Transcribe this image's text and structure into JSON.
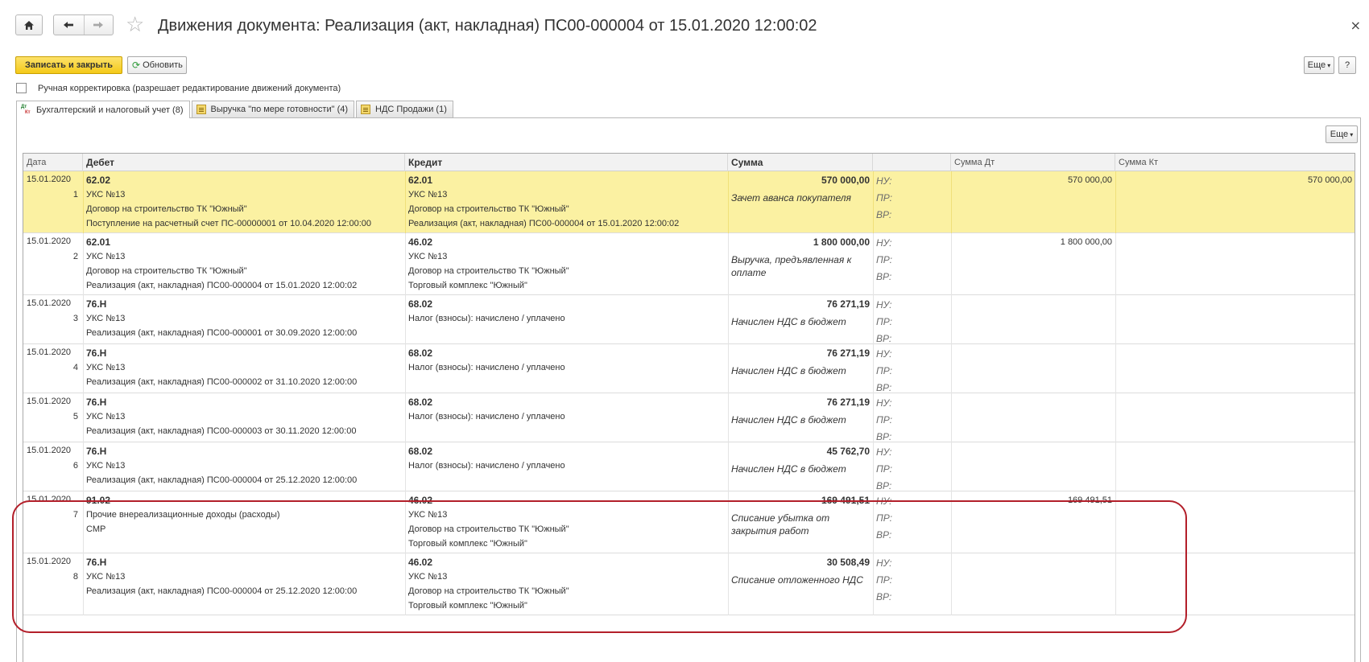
{
  "window": {
    "title": "Движения документа: Реализация (акт, накладная) ПС00-000004 от 15.01.2020 12:00:02",
    "close_glyph": "×"
  },
  "toolbar": {
    "save_close": "Записать и закрыть",
    "refresh": "Обновить",
    "more": "Еще",
    "help": "?"
  },
  "manual": {
    "label": "Ручная корректировка (разрешает редактирование движений документа)",
    "checked": false
  },
  "tabs": [
    {
      "label": "Бухгалтерский и налоговый учет (8)",
      "icon_d": "Дт",
      "icon_k": "Кт"
    },
    {
      "label": "Выручка \"по мере готовности\" (4)"
    },
    {
      "label": "НДС Продажи (1)"
    }
  ],
  "grid": {
    "more": "Еще",
    "headers": {
      "date": "Дата",
      "debit": "Дебет",
      "credit": "Кредит",
      "sum": "Сумма",
      "sum_dt": "Сумма Дт",
      "sum_kt": "Сумма Кт"
    },
    "tags": {
      "nu": "НУ:",
      "pr": "ПР:",
      "vr": "ВР:"
    },
    "rows": [
      {
        "date": "15.01.2020",
        "n": "1",
        "debit": {
          "account": "62.02",
          "sub": [
            "УКС №13",
            "Договор на строительство ТК \"Южный\"",
            "Поступление на расчетный счет ПС-00000001 от 10.04.2020 12:00:00"
          ]
        },
        "credit": {
          "account": "62.01",
          "sub": [
            "УКС №13",
            "Договор на строительство ТК \"Южный\"",
            "Реализация (акт, накладная) ПС00-000004 от 15.01.2020 12:00:02"
          ]
        },
        "sum": "570 000,00",
        "content": "Зачет аванса покупателя",
        "sum_dt": "570 000,00",
        "sum_kt": "570 000,00"
      },
      {
        "date": "15.01.2020",
        "n": "2",
        "debit": {
          "account": "62.01",
          "sub": [
            "УКС №13",
            "Договор на строительство ТК \"Южный\"",
            "Реализация (акт, накладная) ПС00-000004 от 15.01.2020 12:00:02"
          ]
        },
        "credit": {
          "account": "46.02",
          "sub": [
            "УКС №13",
            "Договор на строительство ТК \"Южный\"",
            "Торговый комплекс \"Южный\""
          ]
        },
        "sum": "1 800 000,00",
        "content": "Выручка, предъявленная к оплате",
        "sum_dt": "1 800 000,00",
        "sum_kt": ""
      },
      {
        "date": "15.01.2020",
        "n": "3",
        "debit": {
          "account": "76.Н",
          "sub": [
            "УКС №13",
            "Реализация (акт, накладная) ПС00-000001 от 30.09.2020 12:00:00"
          ]
        },
        "credit": {
          "account": "68.02",
          "sub": [
            "Налог (взносы): начислено / уплачено"
          ]
        },
        "sum": "76 271,19",
        "content": "Начислен НДС в бюджет",
        "sum_dt": "",
        "sum_kt": ""
      },
      {
        "date": "15.01.2020",
        "n": "4",
        "debit": {
          "account": "76.Н",
          "sub": [
            "УКС №13",
            "Реализация (акт, накладная) ПС00-000002 от 31.10.2020 12:00:00"
          ]
        },
        "credit": {
          "account": "68.02",
          "sub": [
            "Налог (взносы): начислено / уплачено"
          ]
        },
        "sum": "76 271,19",
        "content": "Начислен НДС в бюджет",
        "sum_dt": "",
        "sum_kt": ""
      },
      {
        "date": "15.01.2020",
        "n": "5",
        "debit": {
          "account": "76.Н",
          "sub": [
            "УКС №13",
            "Реализация (акт, накладная) ПС00-000003 от 30.11.2020 12:00:00"
          ]
        },
        "credit": {
          "account": "68.02",
          "sub": [
            "Налог (взносы): начислено / уплачено"
          ]
        },
        "sum": "76 271,19",
        "content": "Начислен НДС в бюджет",
        "sum_dt": "",
        "sum_kt": ""
      },
      {
        "date": "15.01.2020",
        "n": "6",
        "debit": {
          "account": "76.Н",
          "sub": [
            "УКС №13",
            "Реализация (акт, накладная) ПС00-000004 от 25.12.2020 12:00:00"
          ]
        },
        "credit": {
          "account": "68.02",
          "sub": [
            "Налог (взносы): начислено / уплачено"
          ]
        },
        "sum": "45 762,70",
        "content": "Начислен НДС в бюджет",
        "sum_dt": "",
        "sum_kt": ""
      },
      {
        "date": "15.01.2020",
        "n": "7",
        "debit": {
          "account": "91.02",
          "sub": [
            "Прочие внереализационные доходы (расходы)",
            "СМР"
          ]
        },
        "credit": {
          "account": "46.02",
          "sub": [
            "УКС №13",
            "Договор на строительство ТК \"Южный\"",
            "Торговый комплекс \"Южный\""
          ]
        },
        "sum": "169 491,51",
        "content": "Списание убытка от закрытия работ",
        "sum_dt": "169 491,51",
        "sum_kt": ""
      },
      {
        "date": "15.01.2020",
        "n": "8",
        "debit": {
          "account": "76.Н",
          "sub": [
            "УКС №13",
            "Реализация (акт, накладная) ПС00-000004 от 25.12.2020 12:00:00"
          ]
        },
        "credit": {
          "account": "46.02",
          "sub": [
            "УКС №13",
            "Договор на строительство ТК \"Южный\"",
            "Торговый комплекс \"Южный\""
          ]
        },
        "sum": "30 508,49",
        "content": "Списание отложенного НДС",
        "sum_dt": "",
        "sum_kt": ""
      }
    ]
  },
  "colors": {
    "selected_row": "#fbf1a2",
    "primary_button": "#f4c919",
    "highlight_ellipse": "#b31f2a"
  }
}
